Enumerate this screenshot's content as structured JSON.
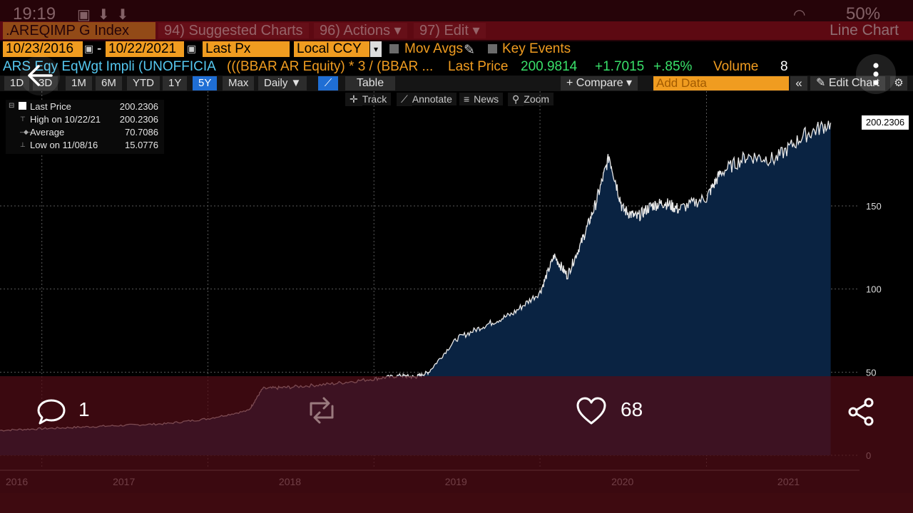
{
  "status": {
    "time": "19:19",
    "battery": "50%"
  },
  "terminal": {
    "ticker": ".AREQIMP G Index",
    "menu": {
      "suggested": "94) Suggested Charts",
      "actions": "96) Actions",
      "edit": "97) Edit"
    },
    "view_label": "Line Chart",
    "start_date": "10/23/2016",
    "date_sep": "-",
    "end_date": "10/22/2021",
    "field": "Last Px",
    "currency": "Local CCY",
    "mov_avgs": "Mov Avgs",
    "key_events": "Key Events",
    "description": "ARS Eqy EqWgt Impli (UNOFFICIA",
    "formula": "(((BBAR AR Equity) * 3 / (BBAR ...",
    "last_price_label": "Last Price",
    "last_price": "200.9814",
    "change": "+1.7015",
    "change_pct": "+.85%",
    "volume_label": "Volume",
    "volume": "8",
    "ranges": [
      "1D",
      "3D",
      "1M",
      "6M",
      "YTD",
      "1Y",
      "5Y",
      "Max"
    ],
    "active_range": "5Y",
    "frequency": "Daily ▼",
    "table_label": "Table",
    "compare_label": "+ Compare ▾",
    "add_data_placeholder": "Add Data",
    "edit_chart": "Edit Chart",
    "tools": [
      "Track",
      "Annotate",
      "News",
      "Zoom"
    ]
  },
  "legend": {
    "last_price_label": "Last Price",
    "last_price_value": "200.2306",
    "high_label": "High on 10/22/21",
    "high_value": "200.2306",
    "average_label": "Average",
    "average_value": "70.7086",
    "low_label": "Low on 11/08/16",
    "low_value": "15.0776"
  },
  "current_price_tag": "200.2306",
  "chart_data": {
    "type": "area",
    "x_labels": [
      "2016",
      "2017",
      "2018",
      "2019",
      "2020",
      "2021"
    ],
    "y_ticks": [
      0,
      50,
      100,
      150
    ],
    "ylim": [
      0,
      210
    ],
    "x": [
      "2016-10",
      "2017-01",
      "2017-04",
      "2017-07",
      "2017-10",
      "2018-01",
      "2018-04",
      "2018-05",
      "2018-07",
      "2018-10",
      "2019-01",
      "2019-03",
      "2019-04",
      "2019-05",
      "2019-07",
      "2019-09",
      "2019-11",
      "2020-01",
      "2020-02",
      "2020-03",
      "2020-04",
      "2020-05",
      "2020-06",
      "2020-07",
      "2020-08",
      "2020-09",
      "2020-10",
      "2020-11",
      "2021-01",
      "2021-02",
      "2021-04",
      "2021-06",
      "2021-08",
      "2021-10"
    ],
    "values": [
      15,
      16,
      17,
      18,
      19,
      22,
      27,
      40,
      41,
      43,
      46,
      48,
      47,
      50,
      70,
      78,
      85,
      98,
      120,
      108,
      128,
      150,
      180,
      148,
      143,
      150,
      152,
      148,
      155,
      170,
      180,
      178,
      192,
      200
    ]
  },
  "social": {
    "comments": "1",
    "likes": "68"
  }
}
